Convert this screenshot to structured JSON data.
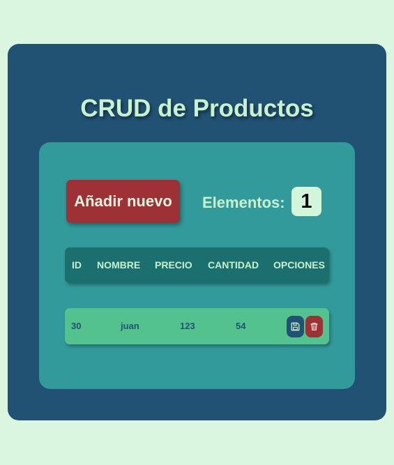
{
  "page": {
    "title": "CRUD de Productos"
  },
  "toolbar": {
    "add_label": "Añadir nuevo",
    "count_label": "Elementos:",
    "count_value": "1"
  },
  "table": {
    "headers": [
      "ID",
      "NOMBRE",
      "PRECIO",
      "CANTIDAD",
      "OPCIONES"
    ],
    "rows": [
      {
        "id": "30",
        "nombre": "juan",
        "precio": "123",
        "cantidad": "54",
        "actions": [
          "floppy-disk-icon",
          "trash-icon"
        ]
      }
    ]
  },
  "colors": {
    "background": "#dbf6e0",
    "outer_panel": "#215173",
    "inner_panel": "#339a9b",
    "header_bar": "#1b706f",
    "row_bar": "#54c28f",
    "accent_red": "#9e3135",
    "text_light": "#c8f2cf"
  }
}
